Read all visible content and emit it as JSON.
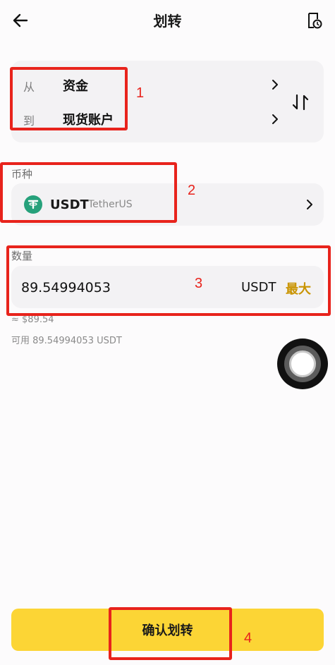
{
  "header": {
    "title": "划转",
    "back_icon": "arrow-left-icon",
    "history_icon": "history-icon"
  },
  "transfer": {
    "from_label": "从",
    "from_value": "资金",
    "to_label": "到",
    "to_value": "现货账户"
  },
  "coin": {
    "section_label": "币种",
    "symbol": "USDT",
    "name": "TetherUS",
    "icon_color": "#26a17b"
  },
  "amount": {
    "section_label": "数量",
    "value": "89.54994053",
    "unit": "USDT",
    "max_label": "最大",
    "approx": "≈ $89.54",
    "available": "可用 89.54994053 USDT"
  },
  "confirm_label": "确认划转",
  "annotations": [
    "1",
    "2",
    "3",
    "4"
  ],
  "colors": {
    "accent": "#fcd535",
    "max": "#c99400",
    "annotation": "#e8231c"
  }
}
